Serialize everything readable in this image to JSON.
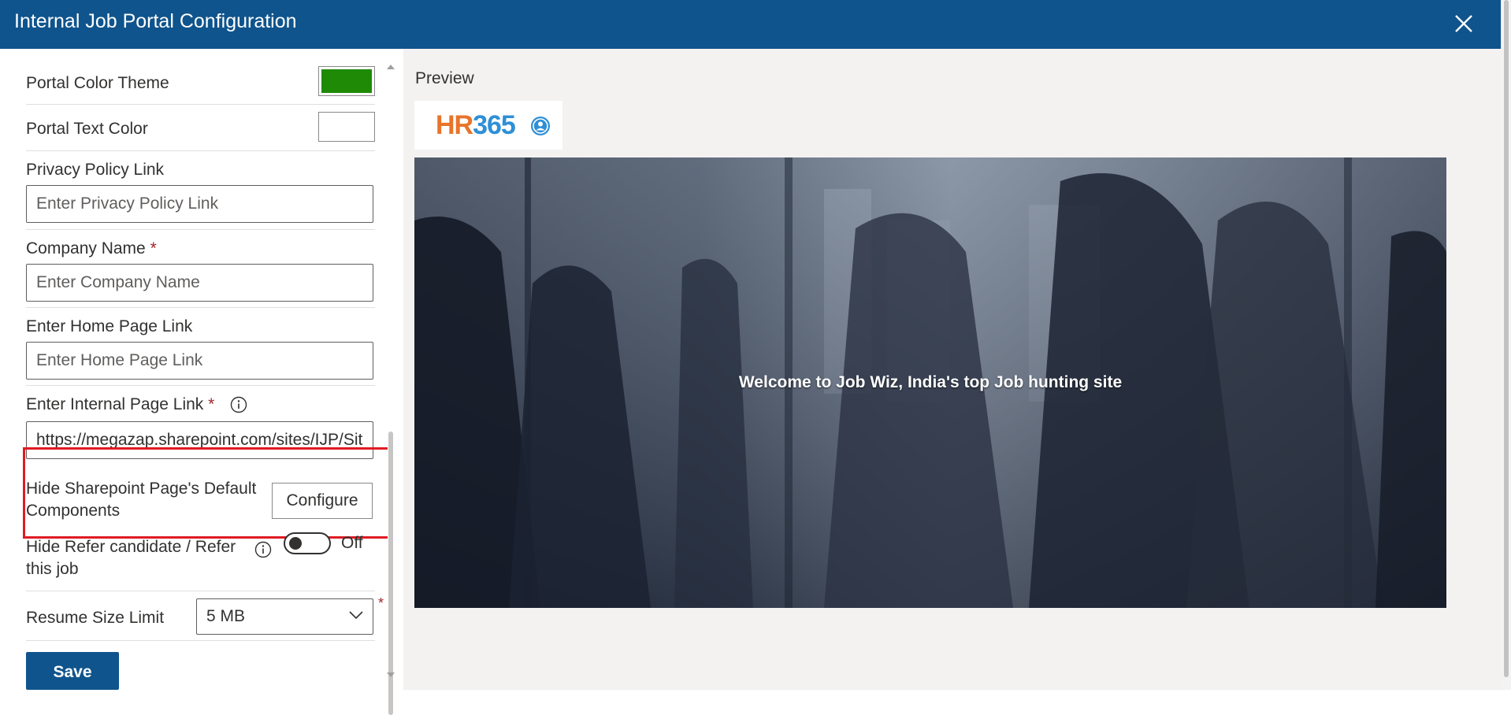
{
  "window": {
    "title": "Internal Job Portal Configuration"
  },
  "form": {
    "portal_color_theme": {
      "label": "Portal Color Theme",
      "color": "#1e8a06"
    },
    "portal_text_color": {
      "label": "Portal Text Color",
      "color": "#ffffff"
    },
    "privacy_policy": {
      "label": "Privacy Policy Link",
      "placeholder": "Enter Privacy Policy Link"
    },
    "company_name": {
      "label": "Company Name",
      "required_mark": "*",
      "placeholder": "Enter Company Name"
    },
    "home_page_link": {
      "label": "Enter Home Page Link",
      "placeholder": "Enter Home Page Link"
    },
    "internal_page_link": {
      "label": "Enter Internal Page Link",
      "required_mark": "*",
      "value": "https://megazap.sharepoint.com/sites/IJP/Sit"
    },
    "hide_default_components": {
      "label": "Hide Sharepoint Page's Default Components",
      "button": "Configure"
    },
    "hide_refer": {
      "label": "Hide Refer candidate / Refer this job",
      "toggle_text": "Off",
      "on": false
    },
    "resume_size": {
      "label": "Resume Size Limit",
      "value": "5 MB",
      "required_mark": "*"
    },
    "save_label": "Save"
  },
  "preview": {
    "label": "Preview",
    "logo": {
      "hr": "HR",
      "num": "365"
    },
    "welcome_text": "Welcome to Job Wiz, India's top Job hunting site"
  },
  "colors": {
    "header": "#0f548c",
    "accent": "#0f548c",
    "highlight": "#e01b24"
  }
}
